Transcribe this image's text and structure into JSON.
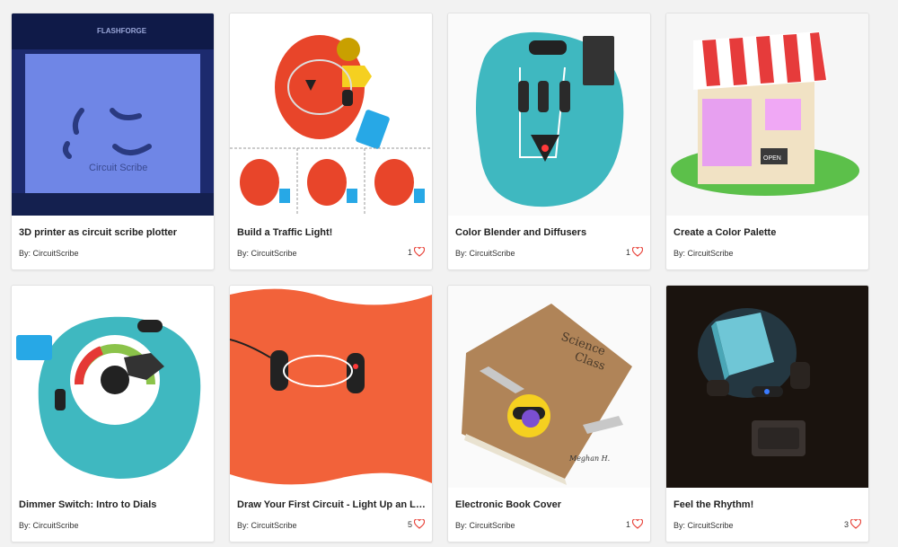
{
  "accent_color": "#e8453c",
  "cards": [
    {
      "title": "3D printer as circuit scribe plotter",
      "author": "By: CircuitScribe",
      "favorites": "",
      "thumb_text": [
        "FLASHFORGE",
        "Circuit Scribe"
      ]
    },
    {
      "title": "Build a Traffic Light!",
      "author": "By: CircuitScribe",
      "favorites": "1"
    },
    {
      "title": "Color Blender and Diffusers",
      "author": "By: CircuitScribe",
      "favorites": "1"
    },
    {
      "title": "Create a Color Palette",
      "author": "By: CircuitScribe",
      "favorites": "",
      "thumb_text": [
        "OPEN"
      ]
    },
    {
      "title": "Dimmer Switch: Intro to Dials",
      "author": "By: CircuitScribe",
      "favorites": ""
    },
    {
      "title": "Draw Your First Circuit - Light Up an LED",
      "author": "By: CircuitScribe",
      "favorites": "5"
    },
    {
      "title": "Electronic Book Cover",
      "author": "By: CircuitScribe",
      "favorites": "1",
      "thumb_text": [
        "Science",
        "Class",
        "Meghan H."
      ]
    },
    {
      "title": "Feel the Rhythm!",
      "author": "By: CircuitScribe",
      "favorites": "3"
    }
  ]
}
